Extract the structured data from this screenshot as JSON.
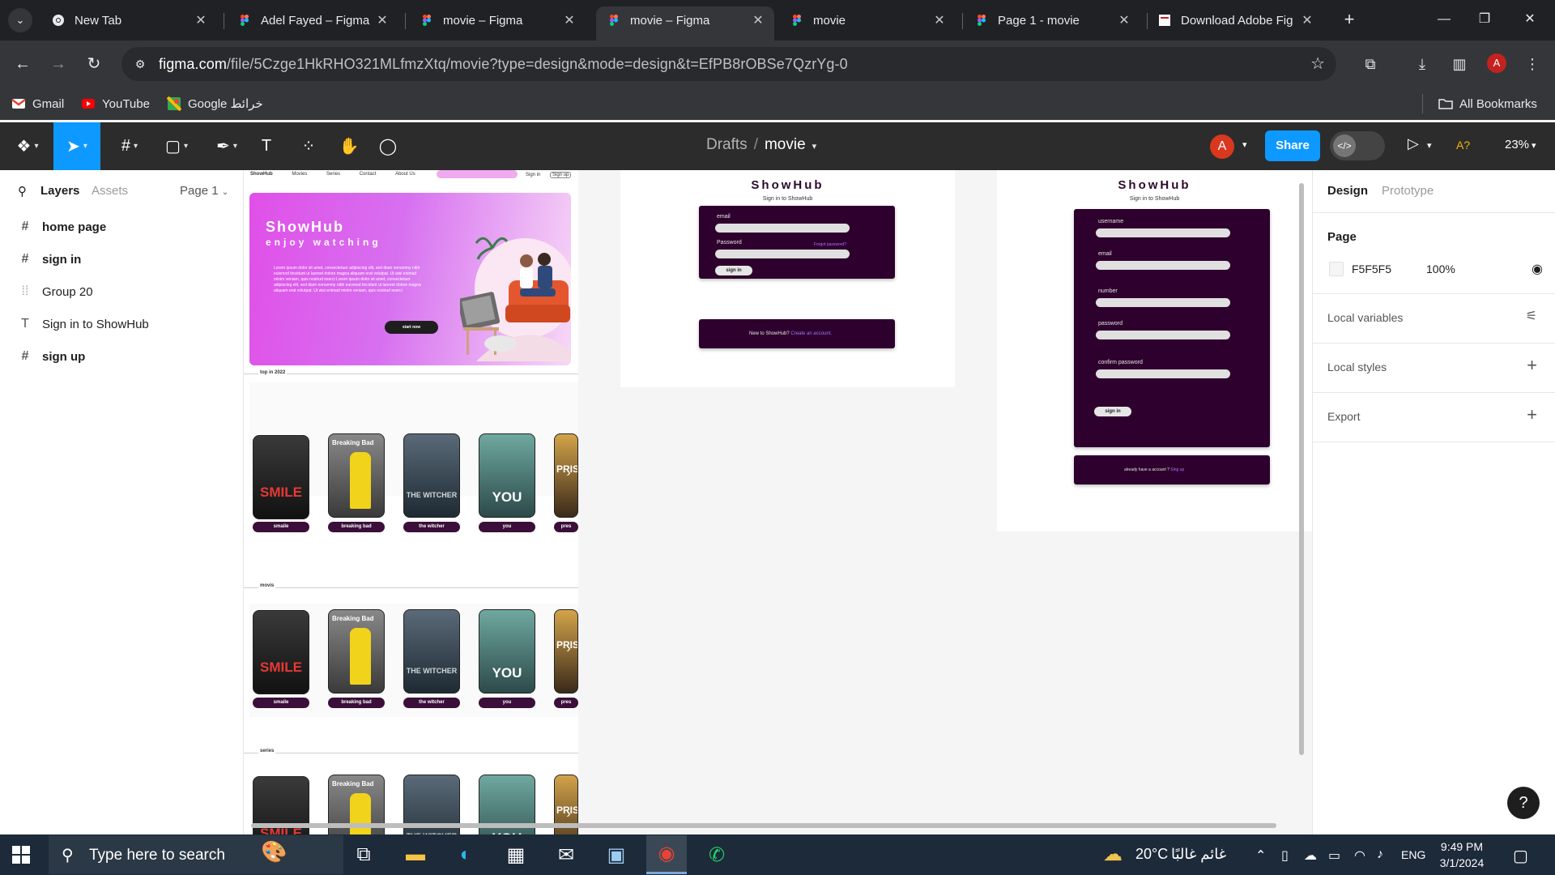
{
  "browser": {
    "tabs": [
      {
        "title": "New Tab",
        "favicon": "chrome-icon",
        "active": false
      },
      {
        "title": "Adel Fayed – Figma",
        "favicon": "figma-icon",
        "active": false
      },
      {
        "title": "movie – Figma",
        "favicon": "figma-icon",
        "active": false
      },
      {
        "title": "movie – Figma",
        "favicon": "figma-icon",
        "active": true
      },
      {
        "title": "movie",
        "favicon": "figma-icon",
        "active": false
      },
      {
        "title": "Page 1 - movie",
        "favicon": "figma-icon",
        "active": false
      },
      {
        "title": "Download Adobe Fig",
        "favicon": "page-icon",
        "active": false
      }
    ],
    "url_host": "figma.com",
    "url_path": "/file/5Czge1HkRHO321MLfmzXtq/movie?type=design&mode=design&t=EfPB8rOBSe7QzrYg-0",
    "profile_initial": "A",
    "bookmarks": [
      {
        "label": "Gmail",
        "icon": "gmail-icon"
      },
      {
        "label": "YouTube",
        "icon": "youtube-icon"
      },
      {
        "label": "Google خرائط",
        "icon": "google-maps-icon"
      }
    ],
    "all_bookmarks": "All Bookmarks"
  },
  "figma": {
    "breadcrumb_root": "Drafts",
    "file_name": "movie",
    "user_initial": "A",
    "share_label": "Share",
    "ai_label": "A?",
    "zoom": "23%",
    "left_panel": {
      "tab_layers": "Layers",
      "tab_assets": "Assets",
      "page_selector": "Page 1",
      "layers": [
        {
          "name": "home page",
          "icon": "frame-icon"
        },
        {
          "name": "sign in",
          "icon": "frame-icon"
        },
        {
          "name": "Group 20",
          "icon": "group-icon"
        },
        {
          "name": "Sign in to ShowHub",
          "icon": "text-icon"
        },
        {
          "name": "sign up",
          "icon": "frame-icon"
        }
      ]
    },
    "right_panel": {
      "tab_design": "Design",
      "tab_prototype": "Prototype",
      "page_heading": "Page",
      "page_color": "F5F5F5",
      "page_opacity": "100%",
      "local_variables": "Local variables",
      "local_styles": "Local styles",
      "export": "Export"
    },
    "help": "?"
  },
  "canvas": {
    "home": {
      "nav_brand": "ShowHub",
      "nav_links": [
        "Movies",
        "Series",
        "Contact",
        "About Us"
      ],
      "nav_signin": "Sign in",
      "nav_signup": "Sign up",
      "hero_title": "ShowHub",
      "hero_subtitle": "enjoy watching",
      "hero_text": "Lorem ipsum dolor sit amet, consectetuer adipiscing elit, sed diam nonummy nibh euismod tincidunt ut laoreet dolore magna aliquam erat volutpat. Ut wisi enimad minim veniam, quis nostrud exerci Lorem ipsum dolor sit amet, consectetuer adipiscing elit, sed diam nonummy nibh euismod tincidunt ut laoreet dolore magna aliquam erat volutpat. Ut wisi enimad minim veniam, quis nostrud exerci",
      "hero_button": "start now",
      "sections": [
        "top in 2022",
        "movis",
        "series"
      ],
      "posters": [
        {
          "title": "SMILE",
          "label": "smaile"
        },
        {
          "title": "Breaking Bad",
          "label": "breaking bad"
        },
        {
          "title": "THE WITCHER",
          "label": "the witcher"
        },
        {
          "title": "YOU",
          "label": "you"
        },
        {
          "title": "PRIS",
          "label": "pres"
        }
      ]
    },
    "signin": {
      "title": "ShowHub",
      "subtitle": "Sign in to ShowHub",
      "email_label": "email",
      "password_label": "Password",
      "forgot": "Forgot password?",
      "button": "sign in",
      "footer_text": "New to ShowHub?",
      "footer_link": "Create an account."
    },
    "signup": {
      "title": "ShowHub",
      "subtitle": "Sign in to ShowHub",
      "username_label": "username",
      "email_label": "email",
      "number_label": "number",
      "password_label": "password",
      "confirm_label": "confirm password",
      "button": "sign in",
      "footer_text": "already have a account ?",
      "footer_link": "Sing up"
    }
  },
  "taskbar": {
    "search_placeholder": "Type here to search",
    "weather_temp": "20°C",
    "weather_text": "غائم غالبًا",
    "language": "ENG",
    "time": "9:49 PM",
    "date": "3/1/2024"
  }
}
